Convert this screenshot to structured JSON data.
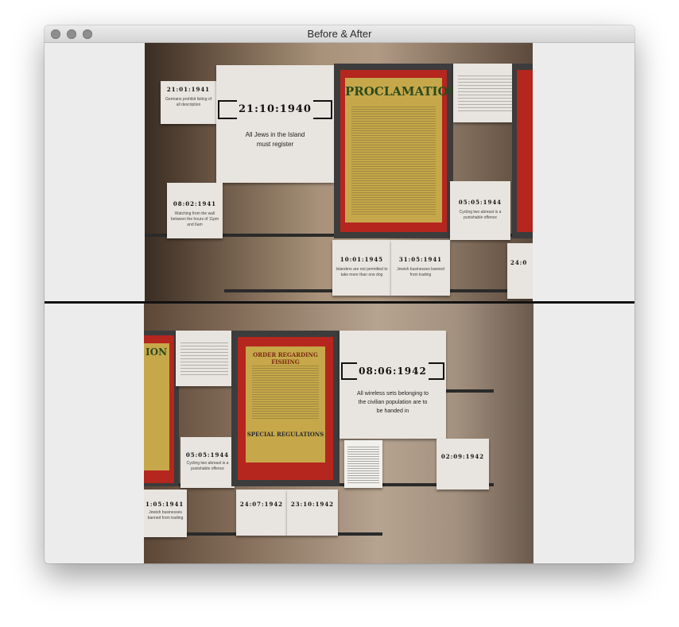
{
  "window": {
    "title": "Before & After"
  },
  "before": {
    "cards": {
      "c1": {
        "date": "21:01:1941",
        "caption": "Germans prohibit listing of all description"
      },
      "c2": {
        "date": "21:10:1940",
        "caption": "All Jews in the Island must register"
      },
      "c3": {
        "date": "08:02:1941",
        "caption": "Watching from the wall between the hours of 11pm and 6am"
      },
      "c4": {
        "date": "05:05:1944",
        "caption": "Cycling two abreast is a punishable offence"
      },
      "c5": {
        "date": "10:01:1945",
        "caption": "Islanders are not permitted to take more than one dog"
      },
      "c6": {
        "date": "31:05:1941",
        "caption": "Jewish businesses banned from trading"
      },
      "c7": {
        "date": "24:0",
        "caption": ""
      }
    },
    "poster_title": "PROCLAMATION"
  },
  "after": {
    "cards": {
      "c1": {
        "date": "08:06:1942",
        "caption": "All wireless sets belonging to the civilian population are to be handed in"
      },
      "c2": {
        "date": "05:05:1944",
        "caption": "Cycling two abreast is a punishable offence"
      },
      "c3": {
        "date": "02:09:1942",
        "caption": ""
      },
      "c4": {
        "date": "1:05:1941",
        "caption": "Jewish businesses banned from trading"
      },
      "c5": {
        "date": "24:07:1942",
        "caption": ""
      },
      "c6": {
        "date": "23:10:1942",
        "caption": ""
      }
    },
    "poster_left_title": "ION",
    "poster_title": "ORDER REGARDING FISHING",
    "poster_sub": "SPECIAL REGULATIONS"
  },
  "colors": {
    "poster_red": "#b5261f",
    "poster_yellow": "#c6a84a",
    "wall": "#a8927a"
  }
}
